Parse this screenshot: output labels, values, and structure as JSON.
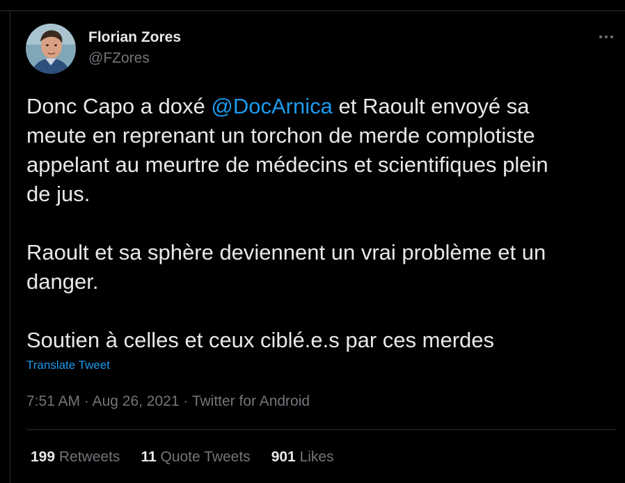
{
  "author": {
    "display_name": "Florian Zores",
    "handle": "@FZores"
  },
  "more_icon": "more-horizontal-icon",
  "tweet": {
    "line1_before": "Donc Capo a doxé ",
    "mention": "@DocArnica",
    "line1_after": " et Raoult envoyé sa",
    "line2": "meute en reprenant un torchon de merde complotiste",
    "line3": "appelant au meurtre de médecins et scientifiques plein",
    "line4": "de jus.",
    "line5": "Raoult et sa sphère deviennent un vrai problème et un",
    "line6": "danger.",
    "line7": "Soutien à celles et ceux ciblé.e.s par ces merdes"
  },
  "translate_label": "Translate Tweet",
  "meta": {
    "time": "7:51 AM",
    "sep1": " · ",
    "date": "Aug 26, 2021",
    "sep2": " · ",
    "source": "Twitter for Android"
  },
  "stats": {
    "retweets_count": "199",
    "retweets_label": "Retweets",
    "quotes_count": "11",
    "quotes_label": "Quote Tweets",
    "likes_count": "901",
    "likes_label": "Likes"
  },
  "colors": {
    "background": "#000000",
    "text": "#e7e9ea",
    "secondary": "#71767b",
    "accent": "#1d9bf0",
    "divider": "#2f3336"
  }
}
